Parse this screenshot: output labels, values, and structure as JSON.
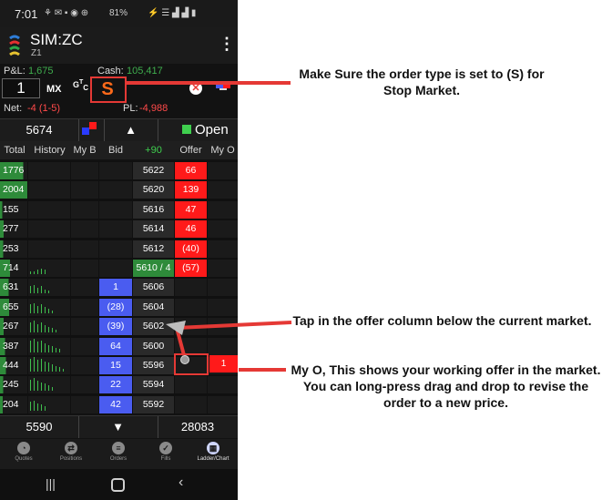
{
  "status_bar": {
    "time": "7:01",
    "battery": "81%"
  },
  "header": {
    "symbol": "SIM:ZC",
    "contract": "Z1"
  },
  "account": {
    "pl_label": "P&L:",
    "pl_value": "1,675",
    "cash_label": "Cash:",
    "cash_value": "105,417",
    "net_label": "Net:",
    "net_value": "-4 (1-5)",
    "open_pl_label": "PL:",
    "open_pl_value": "-4,988"
  },
  "order_entry": {
    "quantity": "1",
    "mx_label": "MX",
    "gtc_label": "GTC",
    "order_type": "S"
  },
  "top_bar": {
    "left_price": "5674",
    "open_label": "Open"
  },
  "columns": [
    "Total",
    "History",
    "My B",
    "Bid",
    "+90",
    "Offer",
    "My O"
  ],
  "ladder_rows": [
    {
      "total": "1776",
      "total_w": 0.85,
      "history": [],
      "bid": "",
      "price": "5622",
      "offer": "66",
      "my_offer": ""
    },
    {
      "total": "2004",
      "total_w": 1.0,
      "history": [],
      "bid": "",
      "price": "5620",
      "offer": "139",
      "my_offer": ""
    },
    {
      "total": "155",
      "total_w": 0.08,
      "history": [],
      "bid": "",
      "price": "5616",
      "offer": "47",
      "my_offer": ""
    },
    {
      "total": "277",
      "total_w": 0.14,
      "history": [],
      "bid": "",
      "price": "5614",
      "offer": "46",
      "my_offer": ""
    },
    {
      "total": "253",
      "total_w": 0.12,
      "history": [],
      "bid": "",
      "price": "5612",
      "offer": "(40)",
      "my_offer": ""
    },
    {
      "total": "714",
      "total_w": 0.36,
      "history": [
        2,
        2,
        3,
        4,
        3
      ],
      "bid": "",
      "price": "5610 / 4",
      "offer": "(57)",
      "my_offer": "",
      "highlight": true
    },
    {
      "total": "631",
      "total_w": 0.32,
      "history": [
        5,
        6,
        4,
        5,
        3,
        2
      ],
      "bid": "1",
      "price": "5606",
      "offer": "",
      "my_offer": ""
    },
    {
      "total": "655",
      "total_w": 0.33,
      "history": [
        6,
        7,
        5,
        6,
        4,
        3,
        2
      ],
      "bid": "(28)",
      "price": "5604",
      "offer": "",
      "my_offer": ""
    },
    {
      "total": "267",
      "total_w": 0.13,
      "history": [
        7,
        8,
        6,
        7,
        5,
        4,
        3,
        2
      ],
      "bid": "(39)",
      "price": "5602",
      "offer": "",
      "my_offer": ""
    },
    {
      "total": "387",
      "total_w": 0.19,
      "history": [
        8,
        9,
        7,
        8,
        6,
        5,
        4,
        3,
        2
      ],
      "bid": "64",
      "price": "5600",
      "offer": "",
      "my_offer": ""
    },
    {
      "total": "444",
      "total_w": 0.22,
      "history": [
        9,
        10,
        8,
        9,
        7,
        6,
        5,
        4,
        3,
        2
      ],
      "bid": "15",
      "price": "5596",
      "offer": "",
      "my_offer": ""
    },
    {
      "total": "245",
      "total_w": 0.12,
      "history": [
        8,
        9,
        7,
        6,
        5,
        4,
        3
      ],
      "bid": "22",
      "price": "5594",
      "offer": "",
      "my_offer": ""
    },
    {
      "total": "204",
      "total_w": 0.1,
      "history": [
        6,
        7,
        5,
        4,
        3
      ],
      "bid": "42",
      "price": "5592",
      "offer": "",
      "my_offer": ""
    }
  ],
  "working_order_label": "1",
  "footer": {
    "left_price": "5590",
    "right_value": "28083"
  },
  "nav": [
    {
      "label": "Quotes",
      "icon": "quotes-icon"
    },
    {
      "label": "Positions",
      "icon": "positions-icon"
    },
    {
      "label": "Orders",
      "icon": "orders-icon"
    },
    {
      "label": "Fills",
      "icon": "fills-icon"
    },
    {
      "label": "Ladder/Chart",
      "icon": "ladder-chart-icon"
    }
  ],
  "annotations": {
    "order_type": "Make Sure the order type is set to (S) for Stop Market.",
    "tap": "Tap in the offer column below the current market.",
    "my_o": "My O, This shows your working offer in the market. You can long-press drag and drop to revise the order to a new price."
  },
  "colors": {
    "bid_blue": "#4a5cf0",
    "offer_red": "#ff1a1a",
    "green": "#2e8b3a",
    "annot_red": "#e53935"
  }
}
